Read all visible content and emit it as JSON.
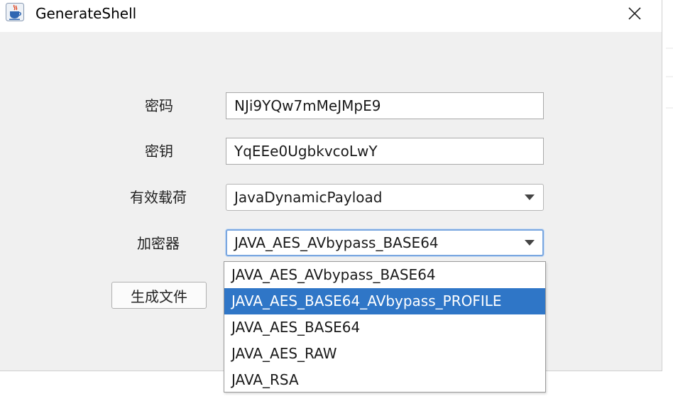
{
  "window": {
    "title": "GenerateShell"
  },
  "form": {
    "password_label": "密码",
    "password_value": "NJi9YQw7mMeJMpE9",
    "key_label": "密钥",
    "key_value": "YqEEe0UgbkvcoLwY",
    "payload_label": "有效载荷",
    "payload_value": "JavaDynamicPayload",
    "encryptor_label": "加密器",
    "encryptor_value": "JAVA_AES_AVbypass_BASE64",
    "generate_button": "生成文件"
  },
  "encryptor_dropdown": {
    "items": [
      {
        "label": "JAVA_AES_AVbypass_BASE64",
        "selected": false
      },
      {
        "label": "JAVA_AES_BASE64_AVbypass_PROFILE",
        "selected": true
      },
      {
        "label": "JAVA_AES_BASE64",
        "selected": false
      },
      {
        "label": "JAVA_AES_RAW",
        "selected": false
      },
      {
        "label": "JAVA_RSA",
        "selected": false
      }
    ]
  },
  "icons": {
    "app": "java-coffee-icon",
    "close": "close-icon",
    "dropdown": "chevron-down-icon"
  },
  "colors": {
    "selection": "#2f76c7",
    "focus_border": "#7aa7e0",
    "dialog_bg": "#f0f0f0"
  }
}
